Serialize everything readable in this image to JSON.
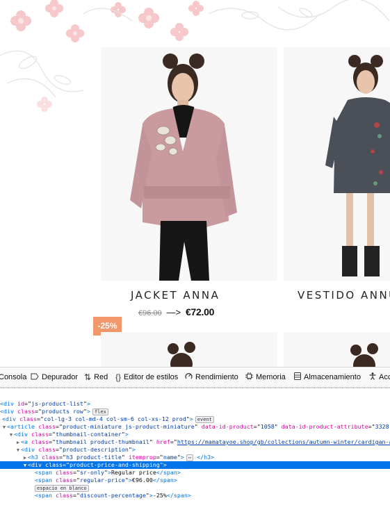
{
  "shop": {
    "products": [
      {
        "title": "JACKET ANNA",
        "old_price": "€96.00",
        "arrow": "—>",
        "new_price": "€72.00",
        "discount": "-25%"
      },
      {
        "title": "VESTIDO ANNU"
      }
    ]
  },
  "devtools": {
    "tabs": [
      {
        "label": "Consola",
        "icon": "console-icon"
      },
      {
        "label": "Depurador",
        "icon": "debugger-icon"
      },
      {
        "label": "Red",
        "icon": "network-icon"
      },
      {
        "label": "Editor de estilos",
        "icon": "style-editor-icon"
      },
      {
        "label": "Rendimiento",
        "icon": "performance-icon"
      },
      {
        "label": "Memoria",
        "icon": "memory-icon"
      },
      {
        "label": "Almacenamiento",
        "icon": "storage-icon"
      },
      {
        "label": "Acc",
        "icon": "accessibility-icon"
      }
    ],
    "tree": {
      "r1": {
        "tag": "div",
        "a1": "id",
        "v1": "js-product-list",
        "close": ">"
      },
      "r2": {
        "tag": "div",
        "a1": "class",
        "v1": "products row",
        "close": ">",
        "badge": "flex"
      },
      "r3": {
        "tag": "div",
        "a1": "class",
        "v1": "col-lg-3 col-md-4 col-sm-6 col-xs-12 prod",
        "close": ">",
        "badge": "event"
      },
      "r4": {
        "tag": "article",
        "a1": "class",
        "v1": "product-miniature js-product-miniature",
        "a2": "data-id-product",
        "v2": "1058",
        "a3": "data-id-product-attribute",
        "v3": "3328"
      },
      "r5": {
        "tag": "div",
        "a1": "class",
        "v1": "thumbnail-container",
        "close": ">"
      },
      "r6": {
        "tag": "a",
        "a1": "class",
        "v1": "thumbnail product-thumbnail",
        "a2": "href",
        "v2": "https://mamatayoe.shop/gb/collections/autumn-winter/cardigan-ann"
      },
      "r7": {
        "tag": "div",
        "a1": "class",
        "v1": "product-description",
        "close": ">"
      },
      "r8": {
        "tag": "h3",
        "a1": "class",
        "v1": "h3 product-title",
        "a2": "itemprop",
        "v2": "name",
        "ellipsis": "⋯",
        "end": "</h3>"
      },
      "r9": {
        "tag": "div",
        "a1": "class",
        "v1": "product-price-and-shipping",
        "close": ">"
      },
      "r10": {
        "tag": "span",
        "a1": "class",
        "v1": "sr-only",
        "text": "Regular price",
        "end": "</span>"
      },
      "r11": {
        "tag": "span",
        "a1": "class",
        "v1": "regular-price",
        "text": "€96.00",
        "end": "</span>"
      },
      "r12": {
        "badge": "espacio en blanco"
      },
      "r13": {
        "tag": "span",
        "a1": "class",
        "v1": "discount-percentage",
        "text": "-25%",
        "end": "</span>"
      }
    }
  },
  "colors": {
    "badge": "#f0976c",
    "selection": "#0074e8",
    "tag": "#0074e8",
    "attr": "#dd00a9",
    "value": "#003eaa"
  }
}
